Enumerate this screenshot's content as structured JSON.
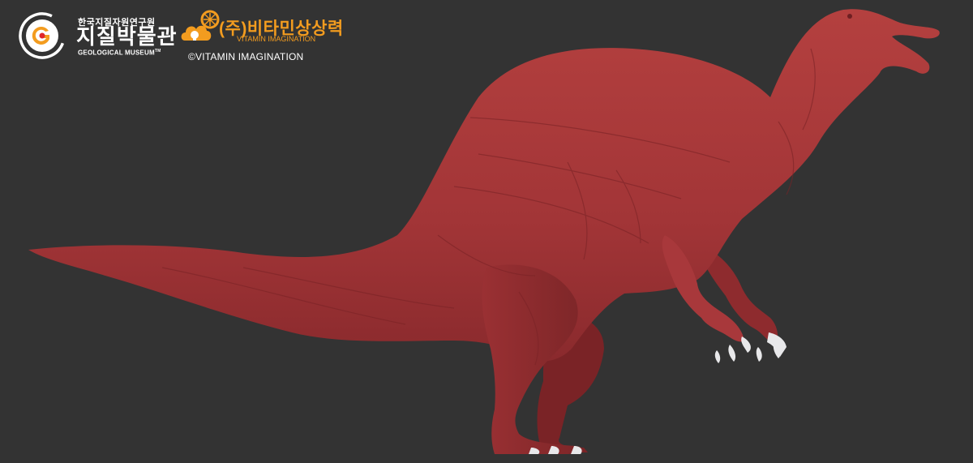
{
  "colors": {
    "background": "#333333",
    "muscle": "#a8383b",
    "muscle_dark": "#7a2326",
    "claw": "#e8e8ea",
    "accent_orange": "#f39c1f"
  },
  "logos": {
    "geological_museum": {
      "icon": "geological-museum-g-icon",
      "korean_small": "한국지질자원연구원",
      "korean_large": "지질박물관",
      "english": "GEOLOGICAL MUSEUM",
      "tm": "TM"
    },
    "vitamin_imagination": {
      "icon": "vitamin-lightbulb-cloud-icon",
      "korean": "(주)비타민상상력",
      "english": "VITAMIN IMAGINATION"
    }
  },
  "copyright": "©VITAMIN IMAGINATION",
  "image": {
    "subject": "dinosaur-muscle-model"
  }
}
